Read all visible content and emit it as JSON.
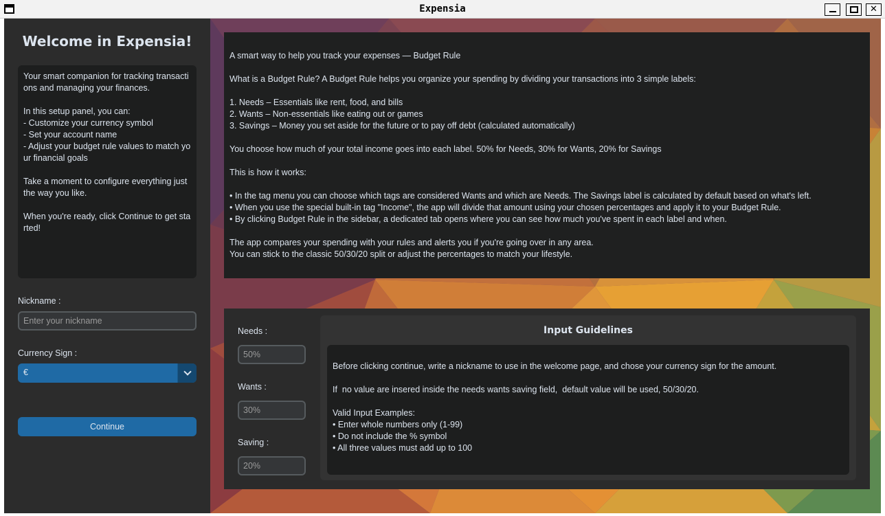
{
  "window": {
    "title": "Expensia"
  },
  "sidebar": {
    "welcome": "Welcome in Expensia!",
    "intro_text": "Your smart companion for tracking transactions and managing your finances.\n\nIn this setup panel, you can:\n- Customize your currency symbol\n- Set your account name\n- Adjust your budget rule values to match your financial goals\n\nTake a moment to configure everything just the way you like.\n\nWhen you're ready, click Continue to get started!",
    "nickname_label": "Nickname :",
    "nickname_placeholder": "Enter your nickname",
    "currency_label": "Currency Sign :",
    "currency_value": "€",
    "continue_label": "Continue"
  },
  "info": {
    "text": "A smart way to help you track your expenses — Budget Rule\n\nWhat is a Budget Rule? A Budget Rule helps you organize your spending by dividing your transactions into 3 simple labels:\n\n1. Needs – Essentials like rent, food, and bills\n2. Wants – Non-essentials like eating out or games\n3. Savings – Money you set aside for the future or to pay off debt (calculated automatically)\n\nYou choose how much of your total income goes into each label. 50% for Needs, 30% for Wants, 20% for Savings\n\nThis is how it works:\n\n• In the tag menu you can choose which tags are considered Wants and which are Needs. The Savings label is calculated by default based on what's left.\n• When you use the special built-in tag \"Income\", the app will divide that amount using your chosen percentages and apply it to your Budget Rule.\n• By clicking Budget Rule in the sidebar, a dedicated tab opens where you can see how much you've spent in each label and when.\n\nThe app compares your spending with your rules and alerts you if you're going over in any area.\nYou can stick to the classic 50/30/20 split or adjust the percentages to match your lifestyle."
  },
  "budget_inputs": {
    "needs_label": "Needs :",
    "needs_placeholder": "50%",
    "wants_label": "Wants :",
    "wants_placeholder": "30%",
    "saving_label": "Saving :",
    "saving_placeholder": "20%"
  },
  "guidelines": {
    "title": "Input Guidelines",
    "text": "Before clicking continue, write a nickname to use in the welcome page, and chose your currency sign for the amount.\n\nIf  no value are insered inside the needs wants saving field,  default value will be used, 50/30/20.\n\nValid Input Examples:\n• Enter whole numbers only (1-99)\n• Do not include the % symbol\n• All three values must add up to 100"
  },
  "icons": {
    "app": "window-icon",
    "minimize": "minimize-icon",
    "maximize": "maximize-icon",
    "close": "close-icon",
    "dropdown": "chevron-down-icon"
  },
  "colors": {
    "accent": "#1f6aa5",
    "panel": "#2b2b2b",
    "text": "#dce4ee"
  }
}
